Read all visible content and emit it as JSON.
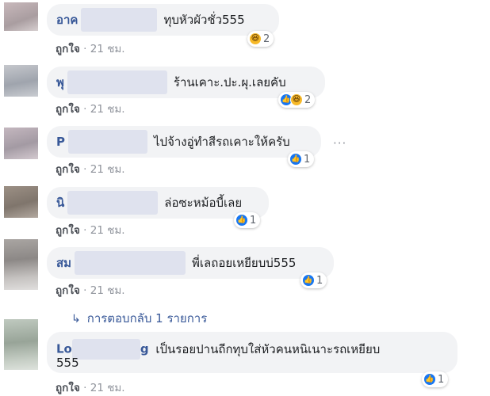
{
  "comments": [
    {
      "name": "อาค",
      "text": "ทุบหัวผัวชั่ว555",
      "like": "ถูกใจ",
      "time": "21 ชม.",
      "count": "2",
      "reactions": [
        "haha-icon"
      ]
    },
    {
      "name": "พุ",
      "text": "ร้านเคาะ.ปะ.ผุ.เลยคับ",
      "like": "ถูกใจ",
      "time": "21 ชม.",
      "count": "2",
      "reactions": [
        "like-icon",
        "haha-icon"
      ]
    },
    {
      "name": "P",
      "text": "ไปจ้างอู่ทำสีรถเคาะให้ครับ",
      "like": "ถูกใจ",
      "time": "21 ชม.",
      "count": "1",
      "reactions": [
        "like-icon"
      ]
    },
    {
      "name": "นิ",
      "text": "ล่อซะหม้อบี้เลย",
      "like": "ถูกใจ",
      "time": "21 ชม.",
      "count": "1",
      "reactions": [
        "like-icon"
      ]
    },
    {
      "name": "สม",
      "text": "พี่เลถอยเหยียบบ่555",
      "like": "ถูกใจ",
      "time": "21 ชม.",
      "count": "1",
      "reactions": [
        "like-icon"
      ]
    },
    {
      "name": "Lo",
      "name_tail": "g",
      "text": "เป็นรอยปานถีกทุบใส่หัวคนหนิเนาะรถเหยียบ",
      "text_line2": "555",
      "like": "ถูกใจ",
      "time": "21 ชม.",
      "count": "1",
      "reactions": [
        "like-icon"
      ]
    }
  ],
  "reply_link": "การตอบกลับ 1 รายการ",
  "more_options": "···",
  "separator": "·",
  "colors": {
    "name": "#385898",
    "bubble": "#f2f3f5",
    "meta": "#90949c",
    "like_reaction": "#1877f2",
    "haha_reaction": "#f7b928"
  }
}
